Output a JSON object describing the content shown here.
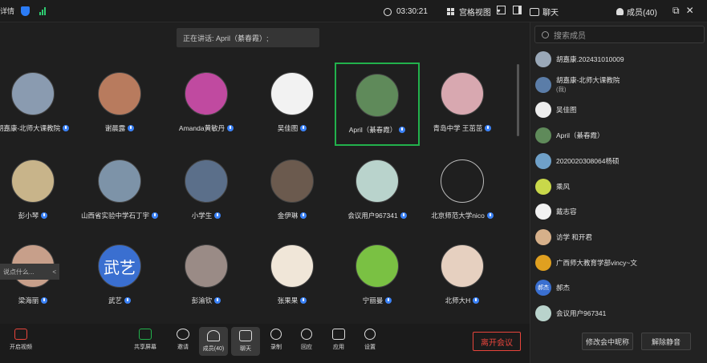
{
  "topbar": {
    "details_label": "详情",
    "timer": "03:30:21",
    "view_label": "宫格视图",
    "chat_label": "聊天",
    "members_label": "成员(40)",
    "accent": "#2b7cf6"
  },
  "speaking": {
    "text": "正在讲话: April（綦春霞）;"
  },
  "tiles": [
    {
      "name": "胡嘉康-北师大课教院",
      "color": "#8a9bb0",
      "initial": "",
      "mic": true
    },
    {
      "name": "谢晨露",
      "color": "#b87b5e",
      "initial": "",
      "mic": true
    },
    {
      "name": "Amanda黄敏丹",
      "color": "#c04aa0",
      "initial": "",
      "mic": true
    },
    {
      "name": "吴佳图",
      "color": "#f2f2f2",
      "initial": "",
      "mic": true
    },
    {
      "name": "April（綦春霞）",
      "color": "#5f8a5a",
      "initial": "",
      "mic": true,
      "active": true
    },
    {
      "name": "青岛中学 王茁茁",
      "color": "#d8a8b0",
      "initial": "",
      "mic": true
    },
    {
      "name": "彭小琴",
      "color": "#c8b48a",
      "initial": "",
      "mic": true
    },
    {
      "name": "山西省实验中学石丁宇",
      "color": "#7d93a8",
      "initial": "",
      "mic": true
    },
    {
      "name": "小学生",
      "color": "#5b6f8a",
      "initial": "",
      "mic": true
    },
    {
      "name": "金伊琳",
      "color": "#6b5a4e",
      "initial": "",
      "mic": true
    },
    {
      "name": "会议用户967341",
      "color": "#b9d3cc",
      "initial": "",
      "mic": true
    },
    {
      "name": "北京师范大学nico",
      "color": "#1f1f1f",
      "initial": "",
      "mic": true
    },
    {
      "name": "梁海丽",
      "color": "#c79f8a",
      "initial": "",
      "mic": true
    },
    {
      "name": "武艺",
      "color": "#3a6fd0",
      "initial": "武艺",
      "mic": true
    },
    {
      "name": "彭渝钦",
      "color": "#9a8b86",
      "initial": "",
      "mic": true
    },
    {
      "name": "张果果",
      "color": "#f0e6d8",
      "initial": "",
      "mic": true
    },
    {
      "name": "宁丽曼",
      "color": "#7ac143",
      "initial": "",
      "mic": true
    },
    {
      "name": "北师大H",
      "color": "#e6d0c0",
      "initial": "",
      "mic": true
    }
  ],
  "sidehint": {
    "text": "说点什么...",
    "arrow": "<"
  },
  "toolbar": {
    "video": "开启视频",
    "share": "共享屏幕",
    "invite": "邀请",
    "members": "成员(40)",
    "chat": "聊天",
    "record": "录制",
    "reaction": "回应",
    "apps": "应用",
    "settings": "设置",
    "leave": "离开会议",
    "leave_color": "#e8453c"
  },
  "panel": {
    "search_placeholder": "搜索成员",
    "members": [
      {
        "name": "胡嘉康.202431010009",
        "sub": "",
        "color": "#9aa8b8",
        "initial": ""
      },
      {
        "name": "胡嘉康-北师大课教院",
        "sub": "(我)",
        "color": "#5b7da8",
        "initial": ""
      },
      {
        "name": "吴佳图",
        "sub": "",
        "color": "#eeeeee",
        "initial": ""
      },
      {
        "name": "April（綦春霞）",
        "sub": "",
        "color": "#5f8a5a",
        "initial": ""
      },
      {
        "name": "2020020308064杨硕",
        "sub": "",
        "color": "#6fa0c8",
        "initial": ""
      },
      {
        "name": "乘风",
        "sub": "",
        "color": "#c9d84a",
        "initial": ""
      },
      {
        "name": "戴志容",
        "sub": "",
        "color": "#f2f2f2",
        "initial": ""
      },
      {
        "name": "访学 和开君",
        "sub": "",
        "color": "#d6b08a",
        "initial": ""
      },
      {
        "name": "广西师大教育学部vincy~文",
        "sub": "",
        "color": "#e0a020",
        "initial": ""
      },
      {
        "name": "郝杰",
        "sub": "",
        "color": "#3a6fd0",
        "initial": "郝杰"
      },
      {
        "name": "会议用户967341",
        "sub": "",
        "color": "#b9d3cc",
        "initial": ""
      }
    ],
    "rename_button": "修改会中昵称",
    "unmute_button": "解除静音"
  }
}
